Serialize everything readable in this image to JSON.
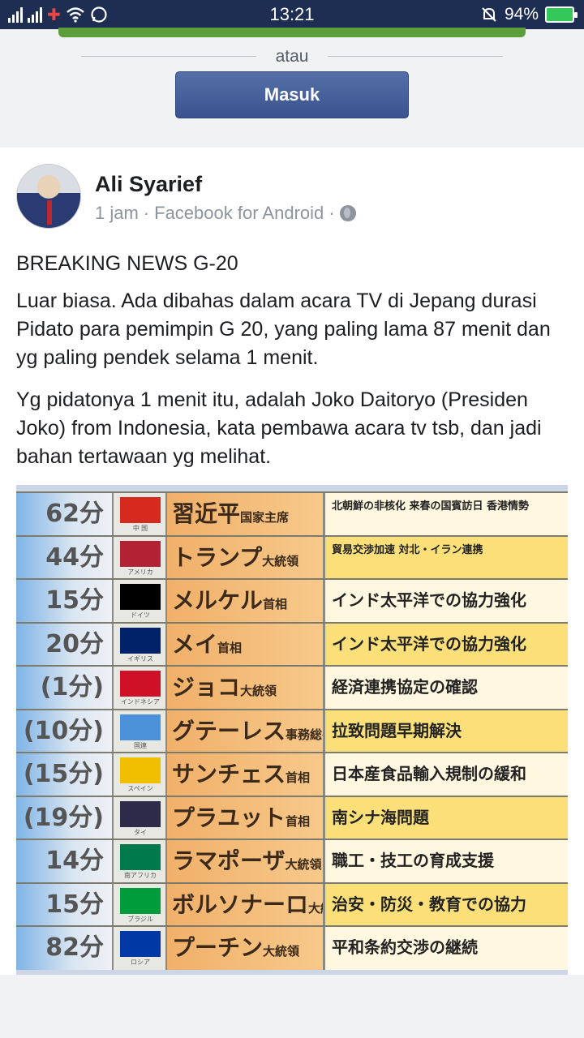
{
  "status_bar": {
    "time": "13:21",
    "battery": "94%",
    "icons": [
      "signal-icon",
      "signal-icon",
      "vodafone-icon",
      "wifi-icon",
      "whatsapp-icon",
      "bell-off-icon",
      "battery-charging-icon"
    ]
  },
  "login": {
    "divider_text": "atau",
    "login_button": "Masuk"
  },
  "post": {
    "author": "Ali Syarief",
    "time": "1 jam",
    "source": "Facebook for Android",
    "separator": "·",
    "privacy_icon": "globe-icon",
    "paragraphs": [
      "BREAKING NEWS G-20",
      "Luar biasa. Ada dibahas dalam acara TV di Jepang durasi Pidato para pemimpin G 20, yang paling lama 87 menit dan yg paling pendek selama 1 menit.",
      "Yg pidatonya 1 menit itu, adalah Joko Daitoryo (Presiden Joko) from Indonesia, kata pembawa acara tv tsb, dan jadi bahan tertawaan yg melihat."
    ]
  },
  "tv_table": {
    "rows": [
      {
        "minutes": "62分",
        "flag_label": "中 国",
        "name": "習近平",
        "title": "国家主席",
        "topic": "北朝鮮の非核化 来春の国賓訪日 香港情勢",
        "flag_color": "#d62a1e"
      },
      {
        "minutes": "44分",
        "flag_label": "アメリカ",
        "name": "トランプ",
        "title": "大統領",
        "topic": "貿易交渉加速 対北・イラン連携",
        "flag_color": "#b22234"
      },
      {
        "minutes": "15分",
        "flag_label": "ドイツ",
        "name": "メルケル",
        "title": "首相",
        "topic": "インド太平洋での協力強化",
        "flag_color": "#000000"
      },
      {
        "minutes": "20分",
        "flag_label": "イギリス",
        "name": "メイ",
        "title": "首相",
        "topic": "インド太平洋での協力強化",
        "flag_color": "#012169"
      },
      {
        "minutes": "(1分)",
        "flag_label": "インドネシア",
        "name": "ジョコ",
        "title": "大統領",
        "topic": "経済連携協定の確認",
        "flag_color": "#ce1126"
      },
      {
        "minutes": "(10分)",
        "flag_label": "国連",
        "name": "グテーレス",
        "title": "事務総長",
        "topic": "拉致問題早期解決",
        "flag_color": "#4b92db"
      },
      {
        "minutes": "(15分)",
        "flag_label": "スペイン",
        "name": "サンチェス",
        "title": "首相",
        "topic": "日本産食品輸入規制の緩和",
        "flag_color": "#f1bf00"
      },
      {
        "minutes": "(19分)",
        "flag_label": "タイ",
        "name": "プラユット",
        "title": "首相",
        "topic": "南シナ海問題",
        "flag_color": "#2d2a4a"
      },
      {
        "minutes": "14分",
        "flag_label": "南アフリカ",
        "name": "ラマポーザ",
        "title": "大統領",
        "topic": "職工・技工の育成支援",
        "flag_color": "#007a4d"
      },
      {
        "minutes": "15分",
        "flag_label": "ブラジル",
        "name": "ボルソナーロ",
        "title": "大統領",
        "topic": "治安・防災・教育での協力",
        "flag_color": "#009c3b"
      },
      {
        "minutes": "82分",
        "flag_label": "ロシア",
        "name": "プーチン",
        "title": "大統領",
        "topic": "平和条約交渉の継続",
        "flag_color": "#0039a6"
      }
    ]
  }
}
